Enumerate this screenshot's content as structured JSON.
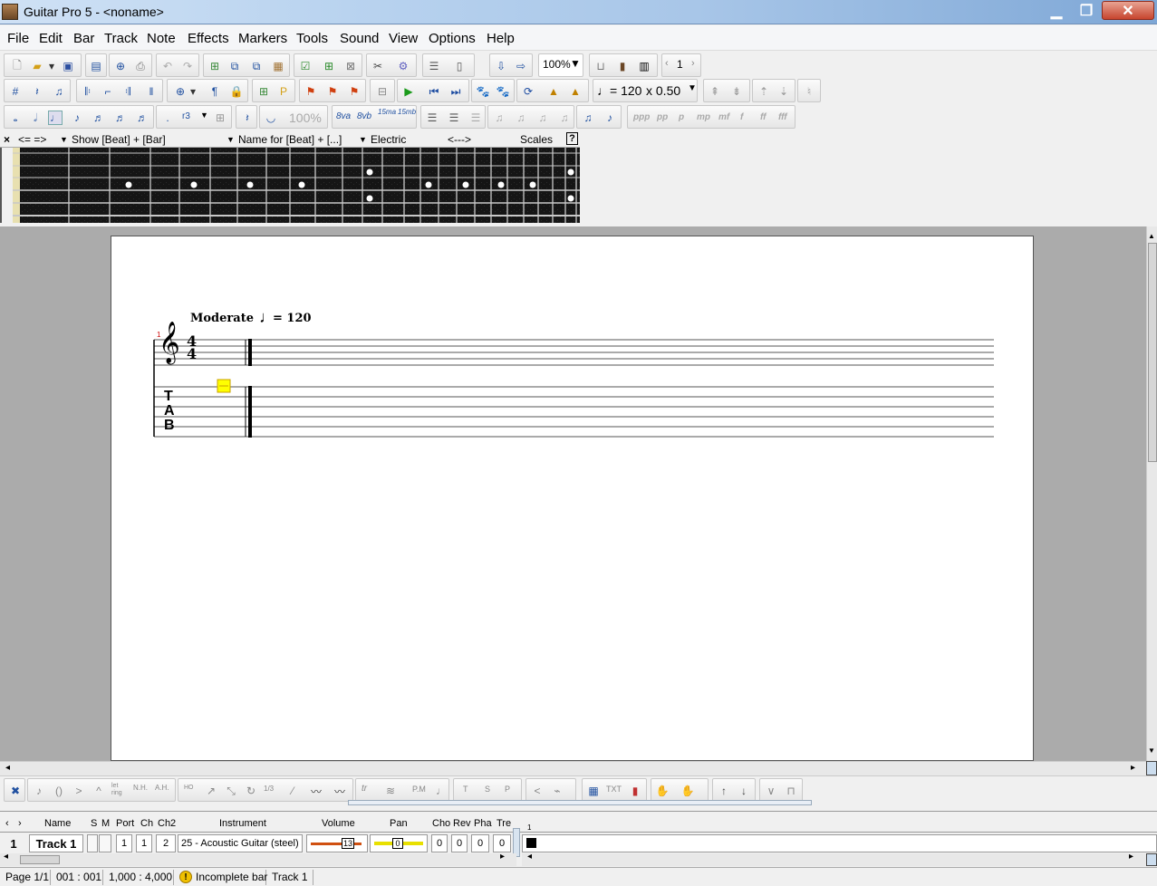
{
  "window": {
    "title": "Guitar Pro 5 - <noname>",
    "minimize": "▁",
    "maximize": "❐",
    "close": "✕"
  },
  "menu": [
    "File",
    "Edit",
    "Bar",
    "Track",
    "Note",
    "Effects",
    "Markers",
    "Tools",
    "Sound",
    "View",
    "Options",
    "Help"
  ],
  "toolbar1": {
    "zoom": "100%",
    "page_number": "1"
  },
  "toolbar2": {
    "tempo": "♩= 120",
    "speed": "x 0.50"
  },
  "toolbar3": {
    "velocity_pct": "100%",
    "ottava": [
      "8va",
      "8vb",
      "15ma",
      "15mb"
    ],
    "dynamics": [
      "ppp",
      "pp",
      "p",
      "mp",
      "mf",
      "f",
      "ff",
      "fff"
    ],
    "tuplet": "r3"
  },
  "fret_header": {
    "nav": "<=  =>",
    "show": "Show [Beat] + [Bar]",
    "name": "Name for [Beat] + [...]",
    "type": "Electric",
    "arrows": "<--->",
    "scales": "Scales",
    "help": "?"
  },
  "score": {
    "tempo_text": "Moderate",
    "tempo_value": "= 120",
    "bar_number": "1",
    "time_sig_top": "4",
    "time_sig_bottom": "4",
    "tab_letters": [
      "T",
      "A",
      "B"
    ]
  },
  "effects_bar": {
    "labels": [
      "let ring",
      "N.H.",
      "A.H.",
      "HO",
      "1/3",
      "tr",
      "P.M",
      "T",
      "S",
      "P",
      "TXT"
    ]
  },
  "tracks": {
    "headers": {
      "name": "Name",
      "s": "S",
      "m": "M",
      "port": "Port",
      "ch": "Ch",
      "ch2": "Ch2",
      "instrument": "Instrument",
      "volume": "Volume",
      "pan": "Pan",
      "cho": "Cho",
      "rev": "Rev",
      "pha": "Pha",
      "tre": "Tre"
    },
    "rows": [
      {
        "number": "1",
        "name": "Track 1",
        "port": "1",
        "ch": "1",
        "ch2": "2",
        "instrument": "25 - Acoustic Guitar (steel)",
        "volume": "13",
        "pan": "0",
        "cho": "0",
        "rev": "0",
        "pha": "0",
        "tre": "0"
      }
    ],
    "bar_header": "1"
  },
  "status": {
    "page": "Page 1/1",
    "position": "001 : 001",
    "duration": "1,000 : 4,000",
    "warning": "Incomplete bar",
    "track": "Track 1"
  },
  "colors": {
    "title_gradient_end": "#7ea7d6",
    "workspace": "#ababab",
    "cursor": "#ffff00",
    "fretboard": "#151515"
  }
}
